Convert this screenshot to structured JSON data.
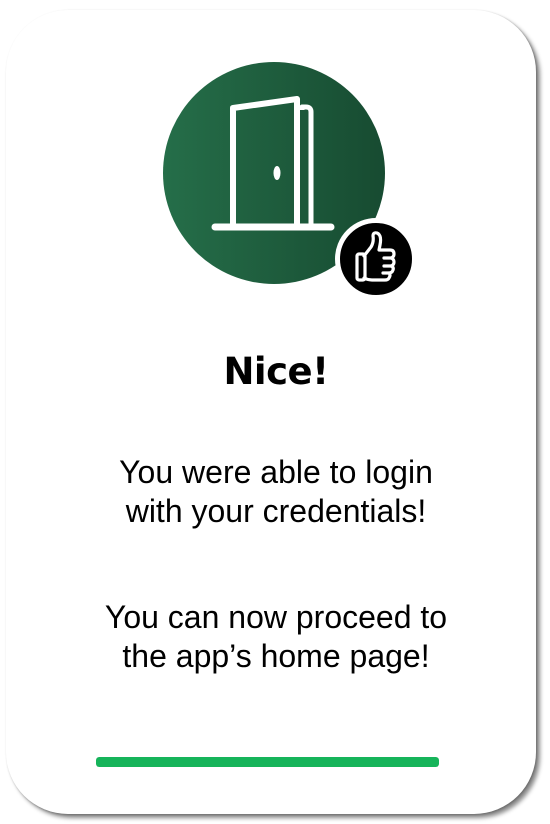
{
  "hero": {
    "icon": "door-open-icon",
    "gradient_start": "#256e49",
    "gradient_end": "#174b31"
  },
  "badge": {
    "icon": "thumbs-up-icon",
    "color": "#000000"
  },
  "title": "Nice!",
  "messages": [
    {
      "lines": [
        "You were able to login",
        "with your credentials!"
      ]
    },
    {
      "lines": [
        "You can now proceed to",
        "the app’s home page!"
      ]
    }
  ],
  "progress": {
    "value": 1.0,
    "color": "#16b45a"
  }
}
